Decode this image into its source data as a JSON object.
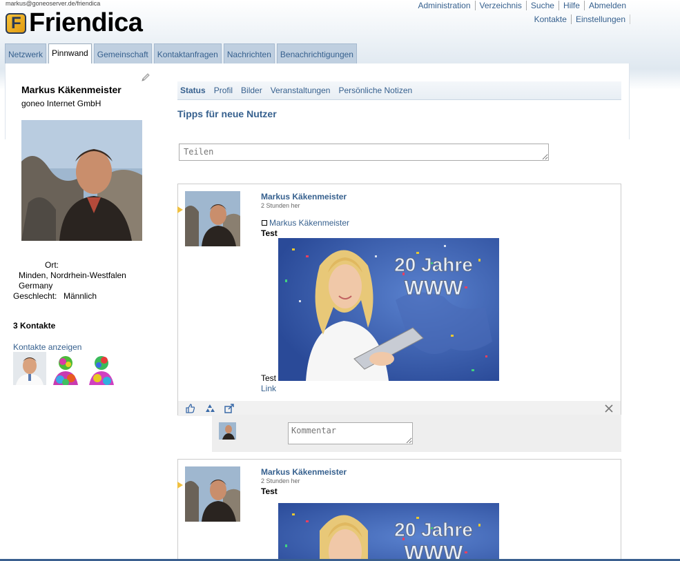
{
  "header": {
    "user_address": "markus@goneoserver.de/friendica",
    "logo_text": "Friendica",
    "top_links_row1": [
      "Administration",
      "Verzeichnis",
      "Suche",
      "Hilfe",
      "Abmelden"
    ],
    "top_links_row2": [
      "Kontakte",
      "Einstellungen"
    ]
  },
  "tabs": [
    {
      "label": "Netzwerk",
      "active": false
    },
    {
      "label": "Pinnwand",
      "active": true
    },
    {
      "label": "Gemeinschaft",
      "active": false
    },
    {
      "label": "Kontaktanfragen",
      "active": false
    },
    {
      "label": "Nachrichten",
      "active": false
    },
    {
      "label": "Benachrichtigungen",
      "active": false
    }
  ],
  "profile": {
    "name": "Markus Käkenmeister",
    "organization": "goneo Internet GmbH",
    "location_label": "Ort:",
    "location_line1": "Minden, Nordrhein-Westfalen",
    "location_line2": "Germany",
    "gender_label": "Geschlecht:",
    "gender_value": "Männlich",
    "contacts_title": "3 Kontakte",
    "contacts_link": "Kontakte anzeigen"
  },
  "subtabs": [
    "Status",
    "Profil",
    "Bilder",
    "Veranstaltungen",
    "Persönliche Notizen"
  ],
  "tips_title": "Tipps für neue Nutzer",
  "share_placeholder": "Teilen",
  "posts": [
    {
      "author": "Markus Käkenmeister",
      "time": "2 Stunden her",
      "owner": "Markus Käkenmeister",
      "title": "Test",
      "image_text": [
        "20 Jahre",
        "WWW"
      ],
      "body": "Test",
      "link": "Link"
    },
    {
      "author": "Markus Käkenmeister",
      "time": "2 Stunden her",
      "title": "Test",
      "image_text": [
        "20 Jahre",
        "WWW"
      ]
    }
  ],
  "comment_placeholder": "Kommentar",
  "icons": {
    "edit": "pencil-icon",
    "like": "thumbs-up-icon",
    "share": "recycle-icon",
    "external": "external-link-icon",
    "delete": "close-icon"
  }
}
